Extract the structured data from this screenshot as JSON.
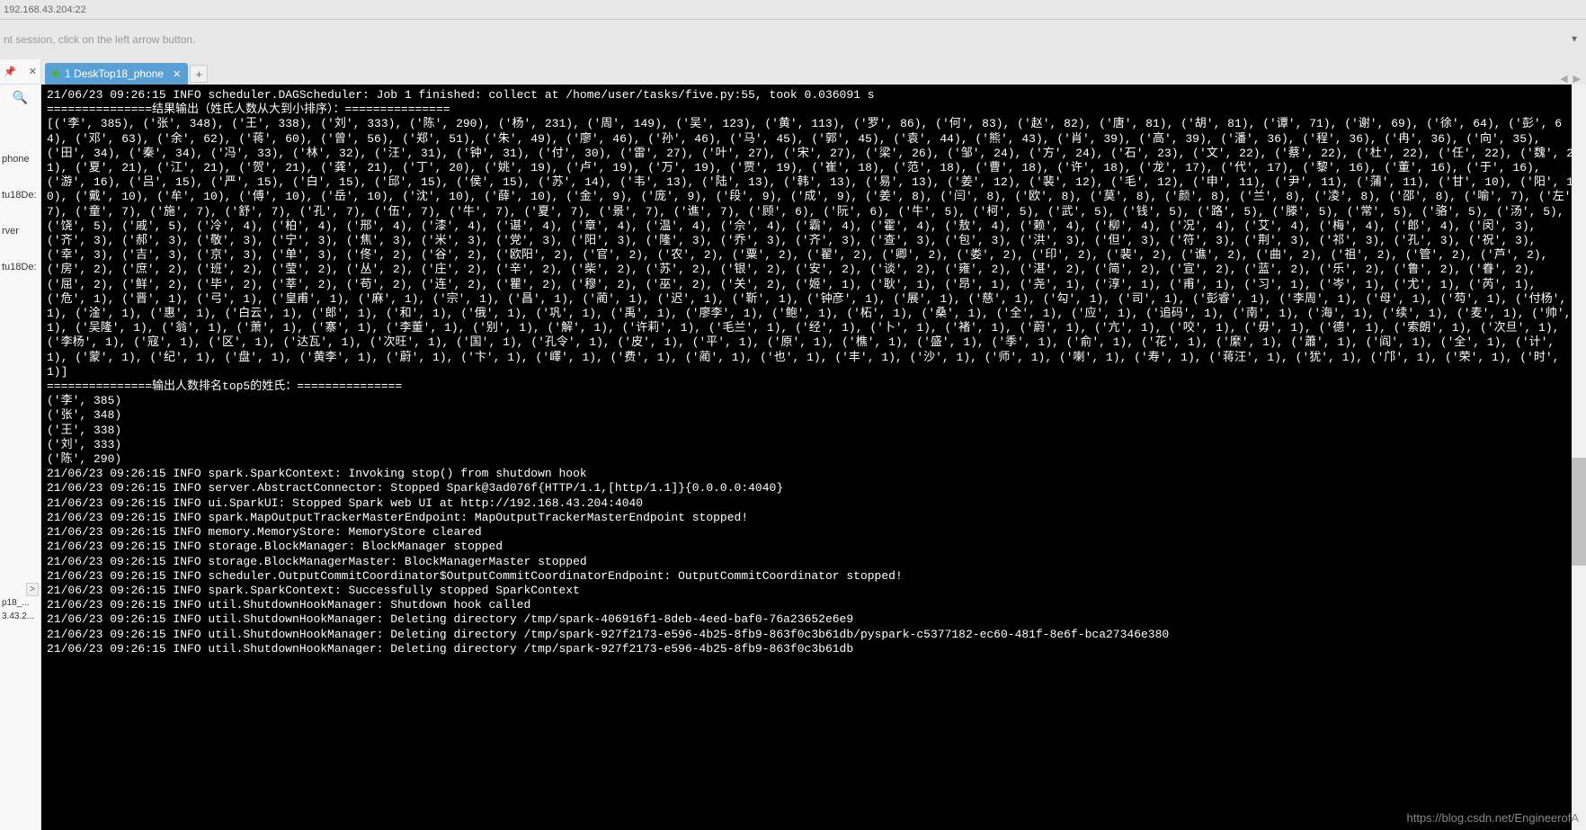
{
  "topBar": {
    "address": "192.168.43.204:22"
  },
  "sessionBar": {
    "hint": "nt session, click on the left arrow button."
  },
  "leftPanel": {
    "items": [
      "phone",
      "tu18De:",
      "rver",
      "tu18De:"
    ],
    "bottomItems": [
      "p18_...",
      "3.43.2..."
    ]
  },
  "tab": {
    "index": "1",
    "title": "DeskTop18_phone"
  },
  "terminal": {
    "lines": [
      "21/06/23 09:26:15 INFO scheduler.DAGScheduler: Job 1 finished: collect at /home/user/tasks/five.py:55, took 0.036091 s",
      "===============结果输出（姓氏人数从大到小排序）：===============",
      "[('李', 385), ('张', 348), ('王', 338), ('刘', 333), ('陈', 290), ('杨', 231), ('周', 149), ('吴', 123), ('黄', 113), ('罗', 86), ('何', 83), ('赵', 82), ('唐', 81), ('胡', 81), ('谭', 71), ('谢', 69), ('徐', 64), ('彭', 64), ('邓', 63), ('余', 62), ('蒋', 60), ('曾', 56), ('郑', 51), ('朱', 49), ('廖', 46), ('孙', 46), ('马', 45), ('郭', 45), ('袁', 44), ('熊', 43), ('肖', 39), ('高', 39), ('潘', 36), ('程', 36), ('冉', 36), ('向', 35), ('田', 34), ('秦', 34), ('冯', 33), ('林', 32), ('汪', 31), ('钟', 31), ('付', 30), ('雷', 27), ('叶', 27), ('宋', 27), ('梁', 26), ('邹', 24), ('方', 24), ('石', 23), ('文', 22), ('蔡', 22), ('杜', 22), ('任', 22), ('魏', 21), ('夏', 21), ('江', 21), ('贺', 21), ('龚', 21), ('丁', 20), ('姚', 19), ('卢', 19), ('万', 19), ('贾', 19), ('崔', 18), ('范', 18), ('曹', 18), ('许', 18), ('龙', 17), ('代', 17), ('黎', 16), ('董', 16), ('于', 16), ('游', 16), ('吕', 15), ('严', 15), ('白', 15), ('邱', 15), ('侯', 15), ('苏', 14), ('韦', 13), ('陆', 13), ('韩', 13), ('易', 13), ('姜', 12), ('裴', 12), ('毛', 12), ('申', 11), ('尹', 11), ('蒲', 11), ('甘', 10), ('阳', 10), ('戴', 10), ('牟', 10), ('傅', 10), ('岳', 10), ('沈', 10), ('薛', 10), ('金', 9), ('庞', 9), ('段', 9), ('成', 9), ('姜', 8), ('闫', 8), ('欧', 8), ('莫', 8), ('颜', 8), ('兰', 8), ('凌', 8), ('邵', 8), ('喻', 7), ('左', 7), ('童', 7), ('施', 7), ('舒', 7), ('孔', 7), ('伍', 7), ('牛', 7), ('夏', 7), ('景', 7), ('谯', 7), ('顾', 6), ('阮', 6), ('牛', 5), ('柯', 5), ('武', 5), ('钱', 5), ('路', 5), ('滕', 5), ('常', 5), ('骆', 5), ('汤', 5), ('饶', 5), ('戚', 5), ('冷', 4), ('柏', 4), ('邢', 4), ('漆', 4), ('谌', 4), ('章', 4), ('温', 4), ('佘', 4), ('霸', 4), ('霍', 4), ('敖', 4), ('赖', 4), ('柳', 4), ('况', 4), ('艾', 4), ('梅', 4), ('郎', 4), ('闵', 3), ('齐', 3), ('郝', 3), ('敬', 3), ('宁', 3), ('焦', 3), ('米', 3), ('党', 3), ('阳', 3), ('隆', 3), ('乔', 3), ('齐', 3), ('查', 3), ('包', 3), ('洪', 3), ('但', 3), ('符', 3), ('荆', 3), ('祁', 3), ('孔', 3), ('祝', 3), ('幸', 3), ('吉', 3), ('京', 3), ('单', 3), ('佟', 2), ('谷', 2), ('欧阳', 2), ('官', 2), ('农', 2), ('粟', 2), ('翟', 2), ('卿', 2), ('娄', 2), ('印', 2), ('裴', 2), ('谯', 2), ('曲', 2), ('祖', 2), ('管', 2), ('芦', 2), ('房', 2), ('庶', 2), ('班', 2), ('莹', 2), ('丛', 2), ('庄', 2), ('辛', 2), ('柴', 2), ('苏', 2), ('银', 2), ('安', 2), ('谈', 2), ('雍', 2), ('湛', 2), ('简', 2), ('宣', 2), ('蓝', 2), ('乐', 2), ('鲁', 2), ('眷', 2), ('屈', 2), ('鲜', 2), ('毕', 2), ('莘', 2), ('苟', 2), ('连', 2), ('瞿', 2), ('穆', 2), ('巫', 2), ('关', 2), ('姬', 1), ('耿', 1), ('昂', 1), ('尧', 1), ('淳', 1), ('甫', 1), ('习', 1), ('岑', 1), ('尤', 1), ('芮', 1), ('危', 1), ('晋', 1), ('弓', 1), ('皇甫', 1), ('麻', 1), ('宗', 1), ('昌', 1), ('蔺', 1), ('迟', 1), ('靳', 1), ('钟彦', 1), ('展', 1), ('慈', 1), ('勾', 1), ('司', 1), ('彭睿', 1), ('李周', 1), ('母', 1), ('芶', 1), ('付杨', 1), ('淦', 1), ('惠', 1), ('白云', 1), ('郎', 1), ('和', 1), ('俄', 1), ('巩', 1), ('禹', 1), ('廖李', 1), ('鲍', 1), ('柘', 1), ('桑', 1), ('全', 1), ('应', 1), ('追码', 1), ('南', 1), ('海', 1), ('续', 1), ('麦', 1), ('帅', 1), ('吴隆', 1), ('翁', 1), ('萧', 1), ('寨', 1), ('李董', 1), ('别', 1), ('解', 1), ('许莉', 1), ('毛兰', 1), ('经', 1), ('卜', 1), ('褚', 1), ('蔚', 1), ('亢', 1), ('咬', 1), ('毋', 1), ('德', 1), ('索朗', 1), ('次旦', 1), ('李杨', 1), ('寇', 1), ('区', 1), ('达瓦', 1), ('次旺', 1), ('国', 1), ('孔令', 1), ('皮', 1), ('平', 1), ('原', 1), ('樵', 1), ('盛', 1), ('季', 1), ('俞', 1), ('花', 1), ('縻', 1), ('蕭', 1), ('阎', 1), ('全', 1), ('计', 1), ('蒙', 1), ('纪', 1), ('盘', 1), ('黄李', 1), ('蔚', 1), ('卞', 1), ('嶧', 1), ('费', 1), ('蔺', 1), ('也', 1), ('丰', 1), ('沙', 1), ('师', 1), ('喇', 1), ('寿', 1), ('蒋汪', 1), ('犹', 1), ('邝', 1), ('荣', 1), ('时', 1)]",
      "===============输出人数排名top5的姓氏：===============",
      "('李', 385)",
      "('张', 348)",
      "('王', 338)",
      "('刘', 333)",
      "('陈', 290)",
      "21/06/23 09:26:15 INFO spark.SparkContext: Invoking stop() from shutdown hook",
      "21/06/23 09:26:15 INFO server.AbstractConnector: Stopped Spark@3ad076f{HTTP/1.1,[http/1.1]}{0.0.0.0:4040}",
      "21/06/23 09:26:15 INFO ui.SparkUI: Stopped Spark web UI at http://192.168.43.204:4040",
      "21/06/23 09:26:15 INFO spark.MapOutputTrackerMasterEndpoint: MapOutputTrackerMasterEndpoint stopped!",
      "21/06/23 09:26:15 INFO memory.MemoryStore: MemoryStore cleared",
      "21/06/23 09:26:15 INFO storage.BlockManager: BlockManager stopped",
      "21/06/23 09:26:15 INFO storage.BlockManagerMaster: BlockManagerMaster stopped",
      "21/06/23 09:26:15 INFO scheduler.OutputCommitCoordinator$OutputCommitCoordinatorEndpoint: OutputCommitCoordinator stopped!",
      "21/06/23 09:26:15 INFO spark.SparkContext: Successfully stopped SparkContext",
      "21/06/23 09:26:15 INFO util.ShutdownHookManager: Shutdown hook called",
      "21/06/23 09:26:15 INFO util.ShutdownHookManager: Deleting directory /tmp/spark-406916f1-8deb-4eed-baf0-76a23652e6e9",
      "21/06/23 09:26:15 INFO util.ShutdownHookManager: Deleting directory /tmp/spark-927f2173-e596-4b25-8fb9-863f0c3b61db/pyspark-c5377182-ec60-481f-8e6f-bca27346e380",
      "21/06/23 09:26:15 INFO util.ShutdownHookManager: Deleting directory /tmp/spark-927f2173-e596-4b25-8fb9-863f0c3b61db"
    ]
  },
  "watermark": "https://blog.csdn.net/EngineerofA"
}
